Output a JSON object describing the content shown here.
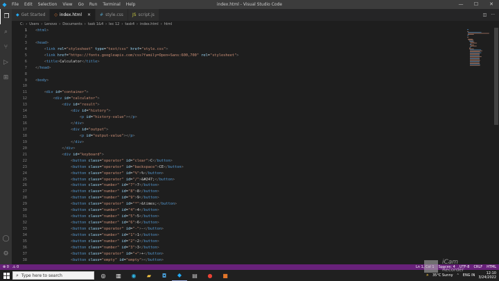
{
  "window": {
    "title": "index.html - Visual Studio Code",
    "menu": [
      "File",
      "Edit",
      "Selection",
      "View",
      "Go",
      "Run",
      "Terminal",
      "Help"
    ]
  },
  "tabs": [
    {
      "label": "Get Started",
      "icon": "vscode-icon",
      "active": false
    },
    {
      "label": "index.html",
      "icon": "html-icon",
      "active": true
    },
    {
      "label": "style.css",
      "icon": "css-icon",
      "active": false
    },
    {
      "label": "script.js",
      "icon": "js-icon",
      "active": false
    }
  ],
  "breadcrumb": [
    "C:",
    "Users",
    "Lenovo",
    "Documents",
    "task 1&4",
    "lec 12",
    "task4",
    "index.html",
    "html"
  ],
  "editor": {
    "current_line": 1,
    "lines": [
      [
        [
          "br",
          "<"
        ],
        [
          "tg",
          "html"
        ],
        [
          "br",
          ">"
        ]
      ],
      [],
      [
        [
          "br",
          "<"
        ],
        [
          "tg",
          "head"
        ],
        [
          "br",
          ">"
        ]
      ],
      [
        [
          "br",
          "    <"
        ],
        [
          "tg",
          "link"
        ],
        [
          "at",
          " rel"
        ],
        [
          "tx",
          "="
        ],
        [
          "sv",
          "\"stylesheet\""
        ],
        [
          "at",
          " type"
        ],
        [
          "tx",
          "="
        ],
        [
          "sv",
          "\"text/css\""
        ],
        [
          "at",
          " href"
        ],
        [
          "tx",
          "="
        ],
        [
          "sv",
          "\"style.css\""
        ],
        [
          "br",
          ">"
        ]
      ],
      [
        [
          "br",
          "    <"
        ],
        [
          "tg",
          "link"
        ],
        [
          "at",
          " href"
        ],
        [
          "tx",
          "="
        ],
        [
          "sv",
          "\"https://fonts.googleapis.com/css?family=Open+Sans:600,700\""
        ],
        [
          "at",
          " rel"
        ],
        [
          "tx",
          "="
        ],
        [
          "sv",
          "\"stylesheet\""
        ],
        [
          "br",
          ">"
        ]
      ],
      [
        [
          "br",
          "    <"
        ],
        [
          "tg",
          "title"
        ],
        [
          "br",
          ">"
        ],
        [
          "tx",
          "Calculator"
        ],
        [
          "br",
          "</"
        ],
        [
          "tg",
          "title"
        ],
        [
          "br",
          ">"
        ]
      ],
      [
        [
          "br",
          "</"
        ],
        [
          "tg",
          "head"
        ],
        [
          "br",
          ">"
        ]
      ],
      [],
      [
        [
          "br",
          "<"
        ],
        [
          "tg",
          "body"
        ],
        [
          "br",
          ">"
        ]
      ],
      [],
      [
        [
          "br",
          "    <"
        ],
        [
          "tg",
          "div"
        ],
        [
          "at",
          " id"
        ],
        [
          "tx",
          "="
        ],
        [
          "sv",
          "\"container\""
        ],
        [
          "br",
          ">"
        ]
      ],
      [
        [
          "br",
          "        <"
        ],
        [
          "tg",
          "div"
        ],
        [
          "at",
          " id"
        ],
        [
          "tx",
          "="
        ],
        [
          "sv",
          "\"calculator\""
        ],
        [
          "br",
          ">"
        ]
      ],
      [
        [
          "br",
          "            <"
        ],
        [
          "tg",
          "div"
        ],
        [
          "at",
          " id"
        ],
        [
          "tx",
          "="
        ],
        [
          "sv",
          "\"result\""
        ],
        [
          "br",
          ">"
        ]
      ],
      [
        [
          "br",
          "                <"
        ],
        [
          "tg",
          "div"
        ],
        [
          "at",
          " id"
        ],
        [
          "tx",
          "="
        ],
        [
          "sv",
          "\"history\""
        ],
        [
          "br",
          ">"
        ]
      ],
      [
        [
          "br",
          "                    <"
        ],
        [
          "tg",
          "p"
        ],
        [
          "at",
          " id"
        ],
        [
          "tx",
          "="
        ],
        [
          "sv",
          "\"history-value\""
        ],
        [
          "br",
          "></"
        ],
        [
          "tg",
          "p"
        ],
        [
          "br",
          ">"
        ]
      ],
      [
        [
          "br",
          "                </"
        ],
        [
          "tg",
          "div"
        ],
        [
          "br",
          ">"
        ]
      ],
      [
        [
          "br",
          "                <"
        ],
        [
          "tg",
          "div"
        ],
        [
          "at",
          " id"
        ],
        [
          "tx",
          "="
        ],
        [
          "sv",
          "\"output\""
        ],
        [
          "br",
          ">"
        ]
      ],
      [
        [
          "br",
          "                    <"
        ],
        [
          "tg",
          "p"
        ],
        [
          "at",
          " id"
        ],
        [
          "tx",
          "="
        ],
        [
          "sv",
          "\"output-value\""
        ],
        [
          "br",
          "></"
        ],
        [
          "tg",
          "p"
        ],
        [
          "br",
          ">"
        ]
      ],
      [
        [
          "br",
          "                </"
        ],
        [
          "tg",
          "div"
        ],
        [
          "br",
          ">"
        ]
      ],
      [
        [
          "br",
          "            </"
        ],
        [
          "tg",
          "div"
        ],
        [
          "br",
          ">"
        ]
      ],
      [
        [
          "br",
          "            <"
        ],
        [
          "tg",
          "div"
        ],
        [
          "at",
          " id"
        ],
        [
          "tx",
          "="
        ],
        [
          "sv",
          "\"keyboard\""
        ],
        [
          "br",
          ">"
        ]
      ],
      [
        [
          "br",
          "                <"
        ],
        [
          "tg",
          "button"
        ],
        [
          "at",
          " class"
        ],
        [
          "tx",
          "="
        ],
        [
          "sv",
          "\"operator\""
        ],
        [
          "at",
          " id"
        ],
        [
          "tx",
          "="
        ],
        [
          "sv",
          "\"clear\""
        ],
        [
          "br",
          ">"
        ],
        [
          "tx",
          "C"
        ],
        [
          "br",
          "</"
        ],
        [
          "tg",
          "button"
        ],
        [
          "br",
          ">"
        ]
      ],
      [
        [
          "br",
          "                <"
        ],
        [
          "tg",
          "button"
        ],
        [
          "at",
          " class"
        ],
        [
          "tx",
          "="
        ],
        [
          "sv",
          "\"operator\""
        ],
        [
          "at",
          " id"
        ],
        [
          "tx",
          "="
        ],
        [
          "sv",
          "\"backspace\""
        ],
        [
          "br",
          ">"
        ],
        [
          "tx",
          "CE"
        ],
        [
          "br",
          "</"
        ],
        [
          "tg",
          "button"
        ],
        [
          "br",
          ">"
        ]
      ],
      [
        [
          "br",
          "                <"
        ],
        [
          "tg",
          "button"
        ],
        [
          "at",
          " class"
        ],
        [
          "tx",
          "="
        ],
        [
          "sv",
          "\"operator\""
        ],
        [
          "at",
          " id"
        ],
        [
          "tx",
          "="
        ],
        [
          "sv",
          "\"%\""
        ],
        [
          "br",
          ">"
        ],
        [
          "tx",
          "%"
        ],
        [
          "br",
          "</"
        ],
        [
          "tg",
          "button"
        ],
        [
          "br",
          ">"
        ]
      ],
      [
        [
          "br",
          "                <"
        ],
        [
          "tg",
          "button"
        ],
        [
          "at",
          " class"
        ],
        [
          "tx",
          "="
        ],
        [
          "sv",
          "\"operator\""
        ],
        [
          "at",
          " id"
        ],
        [
          "tx",
          "="
        ],
        [
          "sv",
          "\"/\""
        ],
        [
          "br",
          ">"
        ],
        [
          "tx",
          "&#247;"
        ],
        [
          "br",
          "</"
        ],
        [
          "tg",
          "button"
        ],
        [
          "br",
          ">"
        ]
      ],
      [
        [
          "br",
          "                <"
        ],
        [
          "tg",
          "button"
        ],
        [
          "at",
          " class"
        ],
        [
          "tx",
          "="
        ],
        [
          "sv",
          "\"number\""
        ],
        [
          "at",
          " id"
        ],
        [
          "tx",
          "="
        ],
        [
          "sv",
          "\"7\""
        ],
        [
          "br",
          ">"
        ],
        [
          "tx",
          "7"
        ],
        [
          "br",
          "</"
        ],
        [
          "tg",
          "button"
        ],
        [
          "br",
          ">"
        ]
      ],
      [
        [
          "br",
          "                <"
        ],
        [
          "tg",
          "button"
        ],
        [
          "at",
          " class"
        ],
        [
          "tx",
          "="
        ],
        [
          "sv",
          "\"number\""
        ],
        [
          "at",
          " id"
        ],
        [
          "tx",
          "="
        ],
        [
          "sv",
          "\"8\""
        ],
        [
          "br",
          ">"
        ],
        [
          "tx",
          "8"
        ],
        [
          "br",
          "</"
        ],
        [
          "tg",
          "button"
        ],
        [
          "br",
          ">"
        ]
      ],
      [
        [
          "br",
          "                <"
        ],
        [
          "tg",
          "button"
        ],
        [
          "at",
          " class"
        ],
        [
          "tx",
          "="
        ],
        [
          "sv",
          "\"number\""
        ],
        [
          "at",
          " id"
        ],
        [
          "tx",
          "="
        ],
        [
          "sv",
          "\"9\""
        ],
        [
          "br",
          ">"
        ],
        [
          "tx",
          "9"
        ],
        [
          "br",
          "</"
        ],
        [
          "tg",
          "button"
        ],
        [
          "br",
          ">"
        ]
      ],
      [
        [
          "br",
          "                <"
        ],
        [
          "tg",
          "button"
        ],
        [
          "at",
          " class"
        ],
        [
          "tx",
          "="
        ],
        [
          "sv",
          "\"operator\""
        ],
        [
          "at",
          " id"
        ],
        [
          "tx",
          "="
        ],
        [
          "sv",
          "\"*\""
        ],
        [
          "br",
          ">"
        ],
        [
          "tx",
          "&times;"
        ],
        [
          "br",
          "</"
        ],
        [
          "tg",
          "button"
        ],
        [
          "br",
          ">"
        ]
      ],
      [
        [
          "br",
          "                <"
        ],
        [
          "tg",
          "button"
        ],
        [
          "at",
          " class"
        ],
        [
          "tx",
          "="
        ],
        [
          "sv",
          "\"number\""
        ],
        [
          "at",
          " id"
        ],
        [
          "tx",
          "="
        ],
        [
          "sv",
          "\"4\""
        ],
        [
          "br",
          ">"
        ],
        [
          "tx",
          "4"
        ],
        [
          "br",
          "</"
        ],
        [
          "tg",
          "button"
        ],
        [
          "br",
          ">"
        ]
      ],
      [
        [
          "br",
          "                <"
        ],
        [
          "tg",
          "button"
        ],
        [
          "at",
          " class"
        ],
        [
          "tx",
          "="
        ],
        [
          "sv",
          "\"number\""
        ],
        [
          "at",
          " id"
        ],
        [
          "tx",
          "="
        ],
        [
          "sv",
          "\"5\""
        ],
        [
          "br",
          ">"
        ],
        [
          "tx",
          "5"
        ],
        [
          "br",
          "</"
        ],
        [
          "tg",
          "button"
        ],
        [
          "br",
          ">"
        ]
      ],
      [
        [
          "br",
          "                <"
        ],
        [
          "tg",
          "button"
        ],
        [
          "at",
          " class"
        ],
        [
          "tx",
          "="
        ],
        [
          "sv",
          "\"number\""
        ],
        [
          "at",
          " id"
        ],
        [
          "tx",
          "="
        ],
        [
          "sv",
          "\"6\""
        ],
        [
          "br",
          ">"
        ],
        [
          "tx",
          "6"
        ],
        [
          "br",
          "</"
        ],
        [
          "tg",
          "button"
        ],
        [
          "br",
          ">"
        ]
      ],
      [
        [
          "br",
          "                <"
        ],
        [
          "tg",
          "button"
        ],
        [
          "at",
          " class"
        ],
        [
          "tx",
          "="
        ],
        [
          "sv",
          "\"operator\""
        ],
        [
          "at",
          " id"
        ],
        [
          "tx",
          "="
        ],
        [
          "sv",
          "\"-\""
        ],
        [
          "br",
          ">"
        ],
        [
          "tx",
          "-"
        ],
        [
          "br",
          "</"
        ],
        [
          "tg",
          "button"
        ],
        [
          "br",
          ">"
        ]
      ],
      [
        [
          "br",
          "                <"
        ],
        [
          "tg",
          "button"
        ],
        [
          "at",
          " class"
        ],
        [
          "tx",
          "="
        ],
        [
          "sv",
          "\"number\""
        ],
        [
          "at",
          " id"
        ],
        [
          "tx",
          "="
        ],
        [
          "sv",
          "\"1\""
        ],
        [
          "br",
          ">"
        ],
        [
          "tx",
          "1"
        ],
        [
          "br",
          "</"
        ],
        [
          "tg",
          "button"
        ],
        [
          "br",
          ">"
        ]
      ],
      [
        [
          "br",
          "                <"
        ],
        [
          "tg",
          "button"
        ],
        [
          "at",
          " class"
        ],
        [
          "tx",
          "="
        ],
        [
          "sv",
          "\"number\""
        ],
        [
          "at",
          " id"
        ],
        [
          "tx",
          "="
        ],
        [
          "sv",
          "\"2\""
        ],
        [
          "br",
          ">"
        ],
        [
          "tx",
          "2"
        ],
        [
          "br",
          "</"
        ],
        [
          "tg",
          "button"
        ],
        [
          "br",
          ">"
        ]
      ],
      [
        [
          "br",
          "                <"
        ],
        [
          "tg",
          "button"
        ],
        [
          "at",
          " class"
        ],
        [
          "tx",
          "="
        ],
        [
          "sv",
          "\"number\""
        ],
        [
          "at",
          " id"
        ],
        [
          "tx",
          "="
        ],
        [
          "sv",
          "\"3\""
        ],
        [
          "br",
          ">"
        ],
        [
          "tx",
          "3"
        ],
        [
          "br",
          "</"
        ],
        [
          "tg",
          "button"
        ],
        [
          "br",
          ">"
        ]
      ],
      [
        [
          "br",
          "                <"
        ],
        [
          "tg",
          "button"
        ],
        [
          "at",
          " class"
        ],
        [
          "tx",
          "="
        ],
        [
          "sv",
          "\"operator\""
        ],
        [
          "at",
          " id"
        ],
        [
          "tx",
          "="
        ],
        [
          "sv",
          "\"+\""
        ],
        [
          "br",
          ">"
        ],
        [
          "tx",
          "+"
        ],
        [
          "br",
          "</"
        ],
        [
          "tg",
          "button"
        ],
        [
          "br",
          ">"
        ]
      ],
      [
        [
          "br",
          "                <"
        ],
        [
          "tg",
          "button"
        ],
        [
          "at",
          " class"
        ],
        [
          "tx",
          "="
        ],
        [
          "sv",
          "\"empty\""
        ],
        [
          "at",
          " id"
        ],
        [
          "tx",
          "="
        ],
        [
          "sv",
          "\"empty\""
        ],
        [
          "br",
          "></"
        ],
        [
          "tg",
          "button"
        ],
        [
          "br",
          ">"
        ]
      ]
    ]
  },
  "statusbar": {
    "left": [
      "⊗ 0",
      "⚠ 0"
    ],
    "right": [
      "Ln 1, Col 1",
      "Spaces: 4",
      "UTF-8",
      "CRLF",
      "HTML"
    ]
  },
  "taskbar": {
    "search_placeholder": "Type here to search",
    "weather": "35°C  Sunny",
    "lang": "ENG IN",
    "time": "12:10",
    "date": "3/24/2022"
  },
  "watermark": {
    "line1": "iCam",
    "line2": "Recorder"
  },
  "colors": {
    "statusbar": "#68217a",
    "titlebar": "#3c3c3c",
    "editor_bg": "#1e1e1e"
  }
}
